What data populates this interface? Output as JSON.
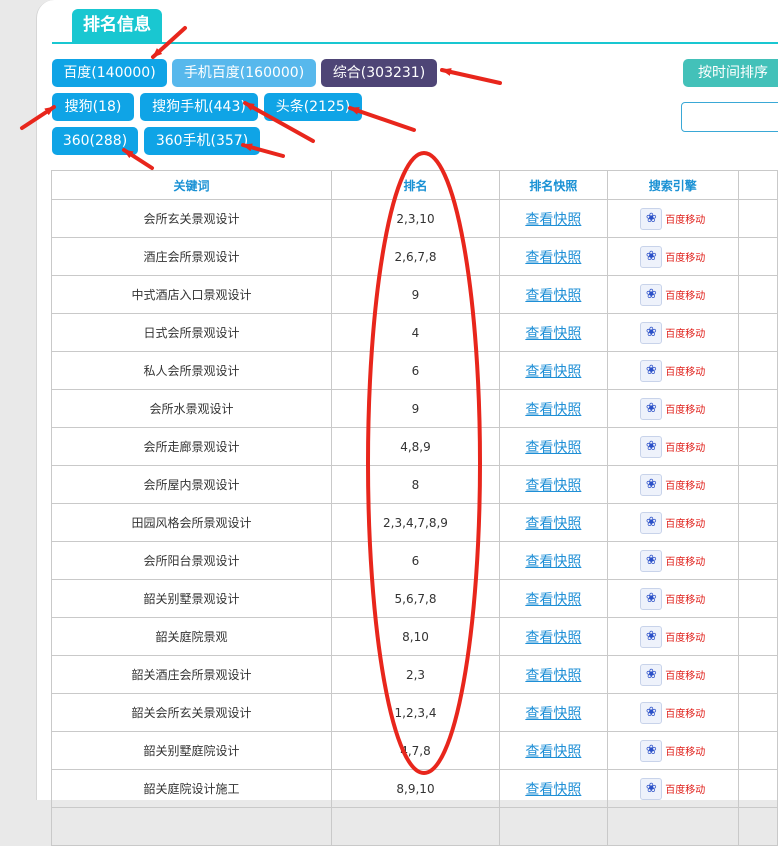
{
  "header": {
    "title": "排名信息"
  },
  "engine_buttons": [
    {
      "label": "百度(140000)",
      "style": "b-blue"
    },
    {
      "label": "手机百度(160000)",
      "style": "b-light"
    },
    {
      "label": "综合(303231)",
      "style": "b-dark"
    },
    {
      "label": "搜狗(18)",
      "style": "b-blue"
    },
    {
      "label": "搜狗手机(443)",
      "style": "b-blue"
    },
    {
      "label": "头条(2125)",
      "style": "b-blue"
    },
    {
      "label": "360(288)",
      "style": "b-blue"
    },
    {
      "label": "360手机(357)",
      "style": "b-blue"
    }
  ],
  "sort_button": {
    "label": "按时间排序"
  },
  "table": {
    "headers": [
      "关键词",
      "排名",
      "排名快照",
      "搜索引擎"
    ],
    "snapshot_label": "查看快照",
    "engine_label": "百度移动",
    "rows": [
      {
        "keyword": "会所玄关景观设计",
        "rank": "2,3,10"
      },
      {
        "keyword": "酒庄会所景观设计",
        "rank": "2,6,7,8"
      },
      {
        "keyword": "中式酒店入口景观设计",
        "rank": "9"
      },
      {
        "keyword": "日式会所景观设计",
        "rank": "4"
      },
      {
        "keyword": "私人会所景观设计",
        "rank": "6"
      },
      {
        "keyword": "会所水景观设计",
        "rank": "9"
      },
      {
        "keyword": "会所走廊景观设计",
        "rank": "4,8,9"
      },
      {
        "keyword": "会所屋内景观设计",
        "rank": "8"
      },
      {
        "keyword": "田园风格会所景观设计",
        "rank": "2,3,4,7,8,9"
      },
      {
        "keyword": "会所阳台景观设计",
        "rank": "6"
      },
      {
        "keyword": "韶关别墅景观设计",
        "rank": "5,6,7,8"
      },
      {
        "keyword": "韶关庭院景观",
        "rank": "8,10"
      },
      {
        "keyword": "韶关酒庄会所景观设计",
        "rank": "2,3"
      },
      {
        "keyword": "韶关会所玄关景观设计",
        "rank": "1,2,3,4"
      },
      {
        "keyword": "韶关别墅庭院设计",
        "rank": "4,7,8"
      },
      {
        "keyword": "韶关庭院设计施工",
        "rank": "8,9,10"
      },
      {
        "keyword": "",
        "rank": ""
      }
    ]
  },
  "colors": {
    "accent": "#19c7d1",
    "button_blue": "#0fa4e6",
    "button_dark": "#4e4576",
    "annotation_red": "#e8261c"
  }
}
